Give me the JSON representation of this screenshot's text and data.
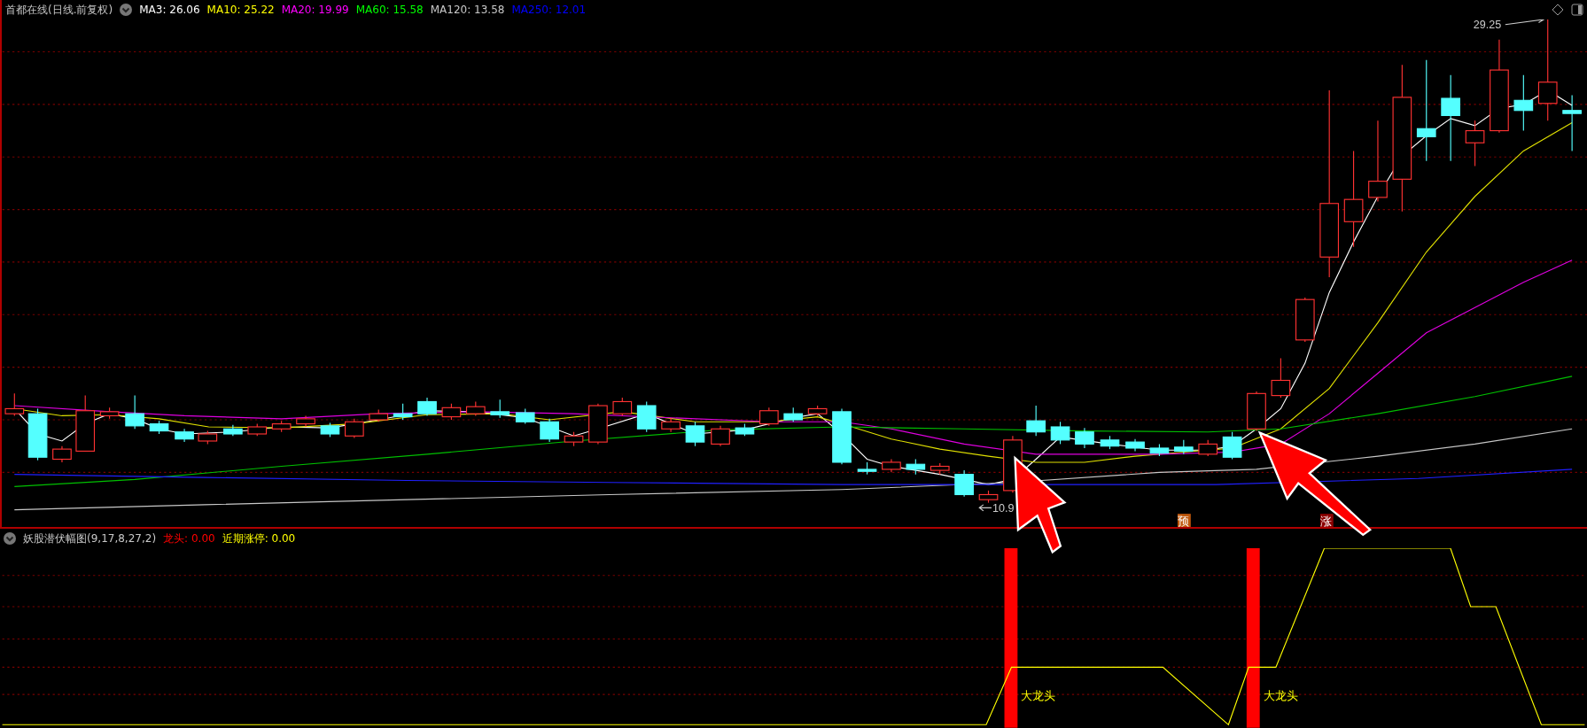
{
  "main_chart": {
    "title": "首都在线(日线.前复权)",
    "indicators": [
      {
        "label": "MA3: 26.06",
        "color": "#ffffff"
      },
      {
        "label": "MA10: 25.22",
        "color": "#ffff00"
      },
      {
        "label": "MA20: 19.99",
        "color": "#ff00ff"
      },
      {
        "label": "MA60: 15.58",
        "color": "#00ff00"
      },
      {
        "label": "MA120: 13.58",
        "color": "#c8c8c8"
      },
      {
        "label": "MA250: 12.01",
        "color": "#0000ff"
      }
    ],
    "high_label": "29.25",
    "low_label": "10.9",
    "markers": [
      {
        "text": "预",
        "color": "#c0580c"
      },
      {
        "text": "涨",
        "color": "#8b0000"
      }
    ]
  },
  "indicator_panel": {
    "title": "妖股潜伏幅图(9,17,8,27,2)",
    "values": [
      {
        "label": "龙头: 0.00",
        "color": "#ff0000"
      },
      {
        "label": "近期涨停: 0.00",
        "color": "#ffff00"
      }
    ],
    "signal_labels": [
      "大龙头",
      "大龙头"
    ]
  }
}
